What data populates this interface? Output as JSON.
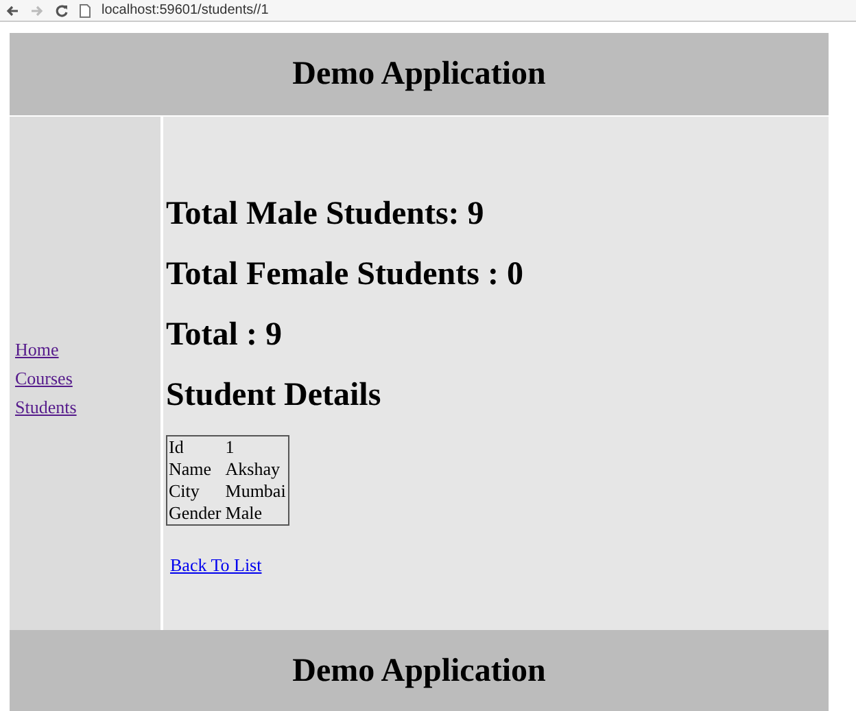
{
  "browser": {
    "address": "localhost:59601/students//1"
  },
  "header": {
    "title": "Demo Application"
  },
  "sidebar": {
    "items": [
      {
        "label": "Home",
        "visited": true
      },
      {
        "label": "Courses",
        "visited": true
      },
      {
        "label": "Students",
        "visited": true
      }
    ]
  },
  "main": {
    "headings": [
      "Total Male Students: 9",
      "Total Female Students : 0",
      "Total : 9"
    ],
    "details_title": "Student Details",
    "details": [
      {
        "label": "Id",
        "value": "1"
      },
      {
        "label": "Name",
        "value": "Akshay"
      },
      {
        "label": "City",
        "value": "Mumbai"
      },
      {
        "label": "Gender",
        "value": "Male"
      }
    ],
    "back_link": {
      "label": "Back To List",
      "visited": false
    }
  },
  "footer": {
    "title": "Demo Application"
  }
}
